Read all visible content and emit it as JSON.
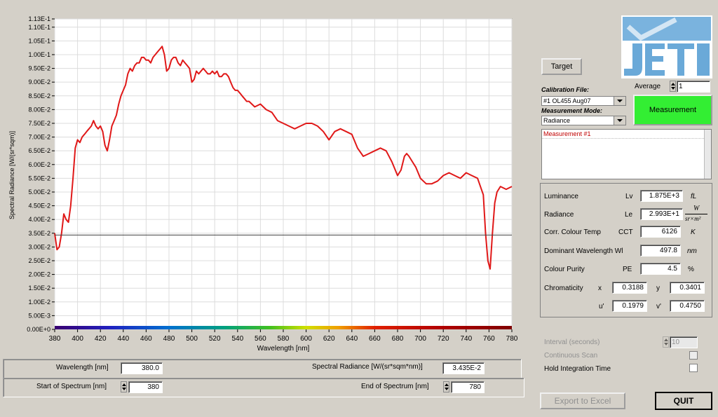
{
  "chart_data": {
    "type": "line",
    "xlabel": "Wavelength [nm]",
    "ylabel": "Spectral Radiance [W/(sr*sqm)]",
    "xlim": [
      380,
      780
    ],
    "ylim": [
      0,
      0.113
    ],
    "x_ticks": [
      380,
      400,
      420,
      440,
      460,
      480,
      500,
      520,
      540,
      560,
      580,
      600,
      620,
      640,
      660,
      680,
      700,
      720,
      740,
      760,
      780
    ],
    "y_ticks": [
      0,
      0.005,
      0.01,
      0.015,
      0.02,
      0.025,
      0.03,
      0.035,
      0.04,
      0.045,
      0.05,
      0.055,
      0.06,
      0.065,
      0.07,
      0.075,
      0.08,
      0.085,
      0.09,
      0.095,
      0.1,
      0.105,
      0.11,
      0.113
    ],
    "y_tick_labels": [
      "0.00E+0",
      "5.00E-3",
      "1.00E-2",
      "1.50E-2",
      "2.00E-2",
      "2.50E-2",
      "3.00E-2",
      "3.50E-2",
      "4.00E-2",
      "4.50E-2",
      "5.00E-2",
      "5.50E-2",
      "6.00E-2",
      "6.50E-2",
      "7.00E-2",
      "7.50E-2",
      "8.00E-2",
      "8.50E-2",
      "9.00E-2",
      "9.50E-2",
      "1.00E-1",
      "1.05E-1",
      "1.10E-1",
      "1.13E-1"
    ],
    "grid": true,
    "cursor_y": 0.03435,
    "series": [
      {
        "color": "#e01818",
        "x": [
          380,
          382,
          384,
          386,
          388,
          390,
          392,
          394,
          396,
          398,
          400,
          402,
          404,
          406,
          408,
          410,
          412,
          414,
          416,
          418,
          420,
          422,
          424,
          426,
          428,
          430,
          432,
          434,
          436,
          438,
          440,
          442,
          444,
          446,
          448,
          450,
          452,
          454,
          456,
          458,
          460,
          462,
          464,
          466,
          468,
          470,
          472,
          474,
          476,
          478,
          480,
          482,
          484,
          486,
          488,
          490,
          492,
          494,
          496,
          498,
          500,
          502,
          504,
          506,
          508,
          510,
          512,
          514,
          516,
          518,
          520,
          522,
          524,
          526,
          528,
          530,
          532,
          534,
          536,
          538,
          540,
          542,
          544,
          546,
          548,
          550,
          555,
          560,
          565,
          570,
          575,
          580,
          585,
          590,
          595,
          600,
          605,
          610,
          615,
          620,
          625,
          630,
          635,
          640,
          645,
          650,
          655,
          660,
          665,
          670,
          675,
          680,
          683,
          686,
          688,
          690,
          693,
          696,
          700,
          705,
          710,
          715,
          720,
          725,
          730,
          735,
          740,
          745,
          750,
          755,
          757,
          759,
          761,
          763,
          765,
          767,
          770,
          775,
          780
        ],
        "y": [
          0.035,
          0.029,
          0.03,
          0.035,
          0.042,
          0.04,
          0.039,
          0.045,
          0.055,
          0.066,
          0.069,
          0.068,
          0.07,
          0.071,
          0.072,
          0.073,
          0.074,
          0.076,
          0.074,
          0.073,
          0.074,
          0.072,
          0.067,
          0.065,
          0.069,
          0.074,
          0.076,
          0.078,
          0.082,
          0.085,
          0.087,
          0.089,
          0.093,
          0.095,
          0.094,
          0.096,
          0.097,
          0.097,
          0.099,
          0.099,
          0.098,
          0.098,
          0.097,
          0.099,
          0.1,
          0.101,
          0.102,
          0.103,
          0.1,
          0.094,
          0.095,
          0.098,
          0.099,
          0.099,
          0.097,
          0.096,
          0.098,
          0.097,
          0.096,
          0.095,
          0.09,
          0.091,
          0.094,
          0.093,
          0.094,
          0.095,
          0.094,
          0.093,
          0.093,
          0.094,
          0.093,
          0.094,
          0.092,
          0.092,
          0.093,
          0.093,
          0.092,
          0.09,
          0.088,
          0.087,
          0.087,
          0.086,
          0.085,
          0.084,
          0.083,
          0.083,
          0.081,
          0.082,
          0.08,
          0.079,
          0.076,
          0.075,
          0.074,
          0.073,
          0.074,
          0.075,
          0.075,
          0.074,
          0.072,
          0.069,
          0.072,
          0.073,
          0.072,
          0.071,
          0.066,
          0.063,
          0.064,
          0.065,
          0.066,
          0.065,
          0.061,
          0.056,
          0.058,
          0.063,
          0.064,
          0.063,
          0.061,
          0.059,
          0.055,
          0.053,
          0.053,
          0.054,
          0.056,
          0.057,
          0.056,
          0.055,
          0.057,
          0.056,
          0.055,
          0.049,
          0.035,
          0.025,
          0.022,
          0.035,
          0.046,
          0.05,
          0.052,
          0.051,
          0.052
        ]
      }
    ]
  },
  "bottom": {
    "wavelength_label": "Wavelength [nm]",
    "wavelength_value": "380.0",
    "spectral_radiance_label": "Spectral Radiance [W/(sr*sqm*nm)]",
    "spectral_radiance_value": "3.435E-2",
    "start_label": "Start of Spectrum [nm]",
    "start_value": "380",
    "end_label": "End of Spectrum [nm]",
    "end_value": "780"
  },
  "controls": {
    "target_label": "Target",
    "calibration_label": "Calibration File:",
    "calibration_value": "#1  OL455 Aug07",
    "average_label": "Average",
    "average_value": "1",
    "mode_label": "Measurement Mode:",
    "mode_value": "Radiance",
    "measurement_button": "Measurement",
    "measurement_list": [
      "Measurement #1"
    ]
  },
  "results": {
    "rows": [
      {
        "name": "Luminance",
        "sym": "Lv",
        "value": "1.875E+3",
        "unit": "fL"
      },
      {
        "name": "Radiance",
        "sym": "Le",
        "value": "2.993E+1",
        "unit_num": "W",
        "unit_den": "sr×m²"
      },
      {
        "name": "Corr. Colour Temp",
        "sym": "CCT",
        "value": "6126",
        "unit": "K"
      },
      {
        "name": "Dominant Wavelength Wl",
        "sym": "",
        "value": "497.8",
        "unit": "nm"
      },
      {
        "name": "Colour Purity",
        "sym": "PE",
        "value": "4.5",
        "unit": "%"
      }
    ],
    "chromaticity_label": "Chromaticity",
    "x_label": "x",
    "x_value": "0.3188",
    "y_label": "y",
    "y_value": "0.3401",
    "u_label": "u'",
    "u_value": "0.1979",
    "v_label": "v'",
    "v_value": "0.4750"
  },
  "options": {
    "interval_label": "Interval  (seconds)",
    "interval_value": "10",
    "continuous_label": "Continuous Scan",
    "hold_label": "Hold Integration Time"
  },
  "actions": {
    "export_label": "Export to Excel",
    "quit_label": "QUIT"
  },
  "colors": {
    "measurement_green": "#33ee33",
    "curve_red": "#e01818",
    "logo_blue": "#6aa9d8"
  }
}
